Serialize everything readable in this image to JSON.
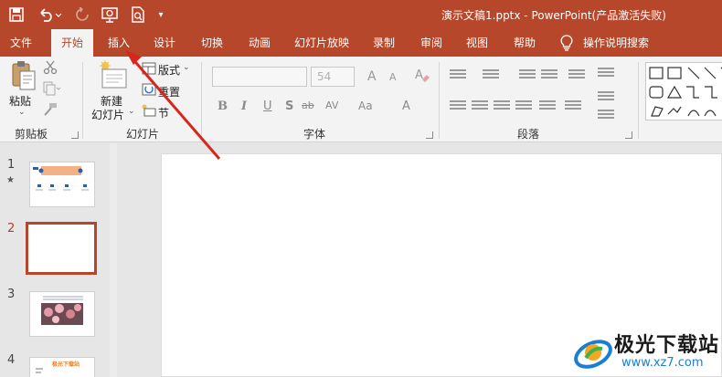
{
  "titlebar": {
    "title": "演示文稿1.pptx  -  PowerPoint(产品激活失败)",
    "accent_color": "#b7472a",
    "quick_access": [
      "save-icon",
      "undo-icon",
      "redo-icon",
      "present-from-start-icon",
      "print-preview-icon",
      "customize-icon"
    ]
  },
  "menu": {
    "tabs": [
      "文件",
      "开始",
      "插入",
      "设计",
      "切换",
      "动画",
      "幻灯片放映",
      "录制",
      "审阅",
      "视图",
      "帮助"
    ],
    "active_tab": "开始",
    "search_label": "操作说明搜索"
  },
  "ribbon": {
    "clipboard": {
      "paste": "粘贴",
      "group": "剪贴板"
    },
    "slides": {
      "new_slide_line1": "新建",
      "new_slide_line2": "幻灯片",
      "layout": "版式",
      "reset": "重置",
      "section": "节",
      "group": "幻灯片"
    },
    "font": {
      "font_name": "",
      "font_size": "54",
      "group": "字体",
      "buttons": [
        "B",
        "I",
        "U",
        "S",
        "ab",
        "AV",
        "Aa",
        "A"
      ],
      "grow": "A",
      "shrink": "A"
    },
    "paragraph": {
      "group": "段落"
    }
  },
  "slides_pane": {
    "slides": [
      {
        "number": "1",
        "star": "★"
      },
      {
        "number": "2",
        "star": ""
      },
      {
        "number": "3",
        "star": ""
      },
      {
        "number": "4",
        "star": ""
      }
    ],
    "selected": "2",
    "slide4_heading": "极光下载站"
  },
  "watermark": {
    "name": "极光下载站",
    "url": "www.xz7.com"
  }
}
